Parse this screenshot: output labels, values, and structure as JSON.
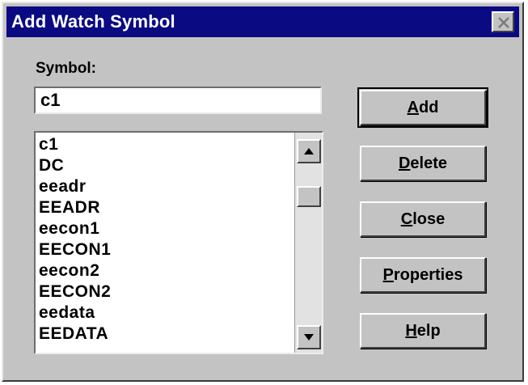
{
  "window": {
    "title": "Add Watch Symbol"
  },
  "symbol": {
    "label": "Symbol:",
    "value": "c1"
  },
  "list": {
    "items": [
      "c1",
      "DC",
      "eeadr",
      "EEADR",
      "eecon1",
      "EECON1",
      "eecon2",
      "EECON2",
      "eedata",
      "EEDATA"
    ]
  },
  "buttons": {
    "add": {
      "mnemonic": "A",
      "rest": "dd"
    },
    "delete": {
      "mnemonic": "D",
      "rest": "elete"
    },
    "close": {
      "mnemonic": "C",
      "rest": "lose"
    },
    "properties": {
      "mnemonic": "P",
      "rest": "roperties"
    },
    "help": {
      "mnemonic": "H",
      "rest": "elp"
    }
  },
  "colors": {
    "titlebar": "#0a0a82",
    "face": "#c3c3c3"
  },
  "icons": {
    "close": "close-x-icon",
    "scroll_up": "triangle-up-icon",
    "scroll_down": "triangle-down-icon"
  }
}
